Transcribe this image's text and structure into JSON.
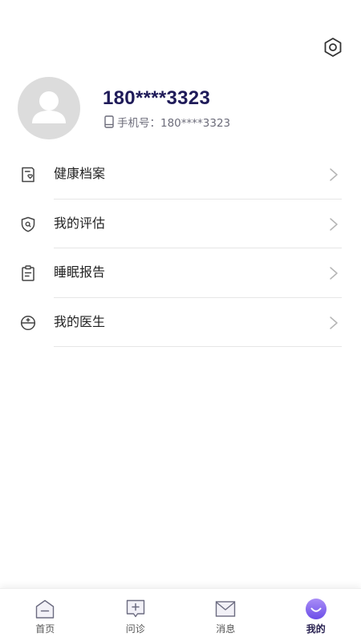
{
  "header": {
    "settings_icon": "settings-hexagon-icon"
  },
  "profile": {
    "avatar_icon": "user-avatar-icon",
    "phone_title": "180****3323",
    "phone_sub": "手机号：180****3323",
    "phone_icon": "mobile-phone-icon"
  },
  "menu": {
    "items": [
      {
        "label": "健康档案",
        "icon": "health-record-icon"
      },
      {
        "label": "我的评估",
        "icon": "assessment-shield-icon"
      },
      {
        "label": "睡眠报告",
        "icon": "sleep-report-clipboard-icon"
      },
      {
        "label": "我的医生",
        "icon": "doctor-icon"
      }
    ]
  },
  "tabbar": {
    "tabs": [
      {
        "label": "首页",
        "icon": "home-icon",
        "active": false
      },
      {
        "label": "问诊",
        "icon": "consult-icon",
        "active": false
      },
      {
        "label": "消息",
        "icon": "message-icon",
        "active": false
      },
      {
        "label": "我的",
        "icon": "profile-smile-icon",
        "active": true
      }
    ]
  },
  "colors": {
    "accent": "#7b5cf0",
    "title": "#1f1b59",
    "icon": "#444444",
    "avatar_bg": "#dcdcdc"
  }
}
